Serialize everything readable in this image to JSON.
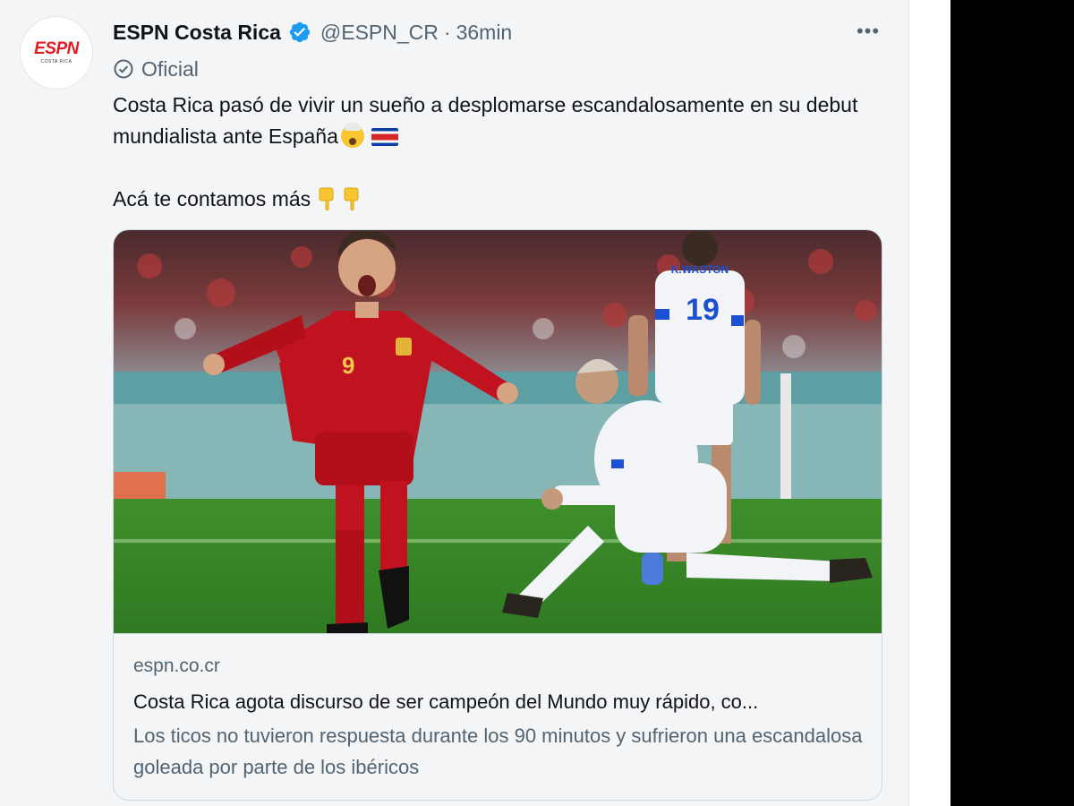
{
  "tweet": {
    "author_name": "ESPN Costa Rica",
    "handle": "@ESPN_CR",
    "separator": "·",
    "time": "36min",
    "label": "Oficial",
    "more_glyph": "•••",
    "avatar_logo": "ESPN",
    "avatar_sub": "COSTA RICA",
    "text_line1": "Costa Rica pasó de vivir un sueño a desplomarse escandalosamente en su debut mundialista ante España",
    "text_line2": "Acá te contamos más",
    "emojis": [
      "exploding-head-emoji",
      "costa-rica-flag-emoji",
      "pointing-down-emoji",
      "pointing-down-emoji"
    ]
  },
  "card": {
    "domain": "espn.co.cr",
    "title": "Costa Rica agota discurso de ser campeón del Mundo muy rápido, co...",
    "description": "Los ticos no tuvieron respuesta durante los 90 minutos y sufrieron una escandalosa goleada por parte de los ibéricos",
    "image": {
      "player_red_number": "9",
      "player_white_name": "K.WASTON",
      "player_white_number": "19"
    }
  },
  "colors": {
    "background": "#f4f5f7",
    "text_primary": "#0f1419",
    "text_secondary": "#536471",
    "verified_blue": "#1d9bf0",
    "espn_red": "#e01b24",
    "border": "#cfd9de",
    "sidebar_black": "#000000"
  }
}
